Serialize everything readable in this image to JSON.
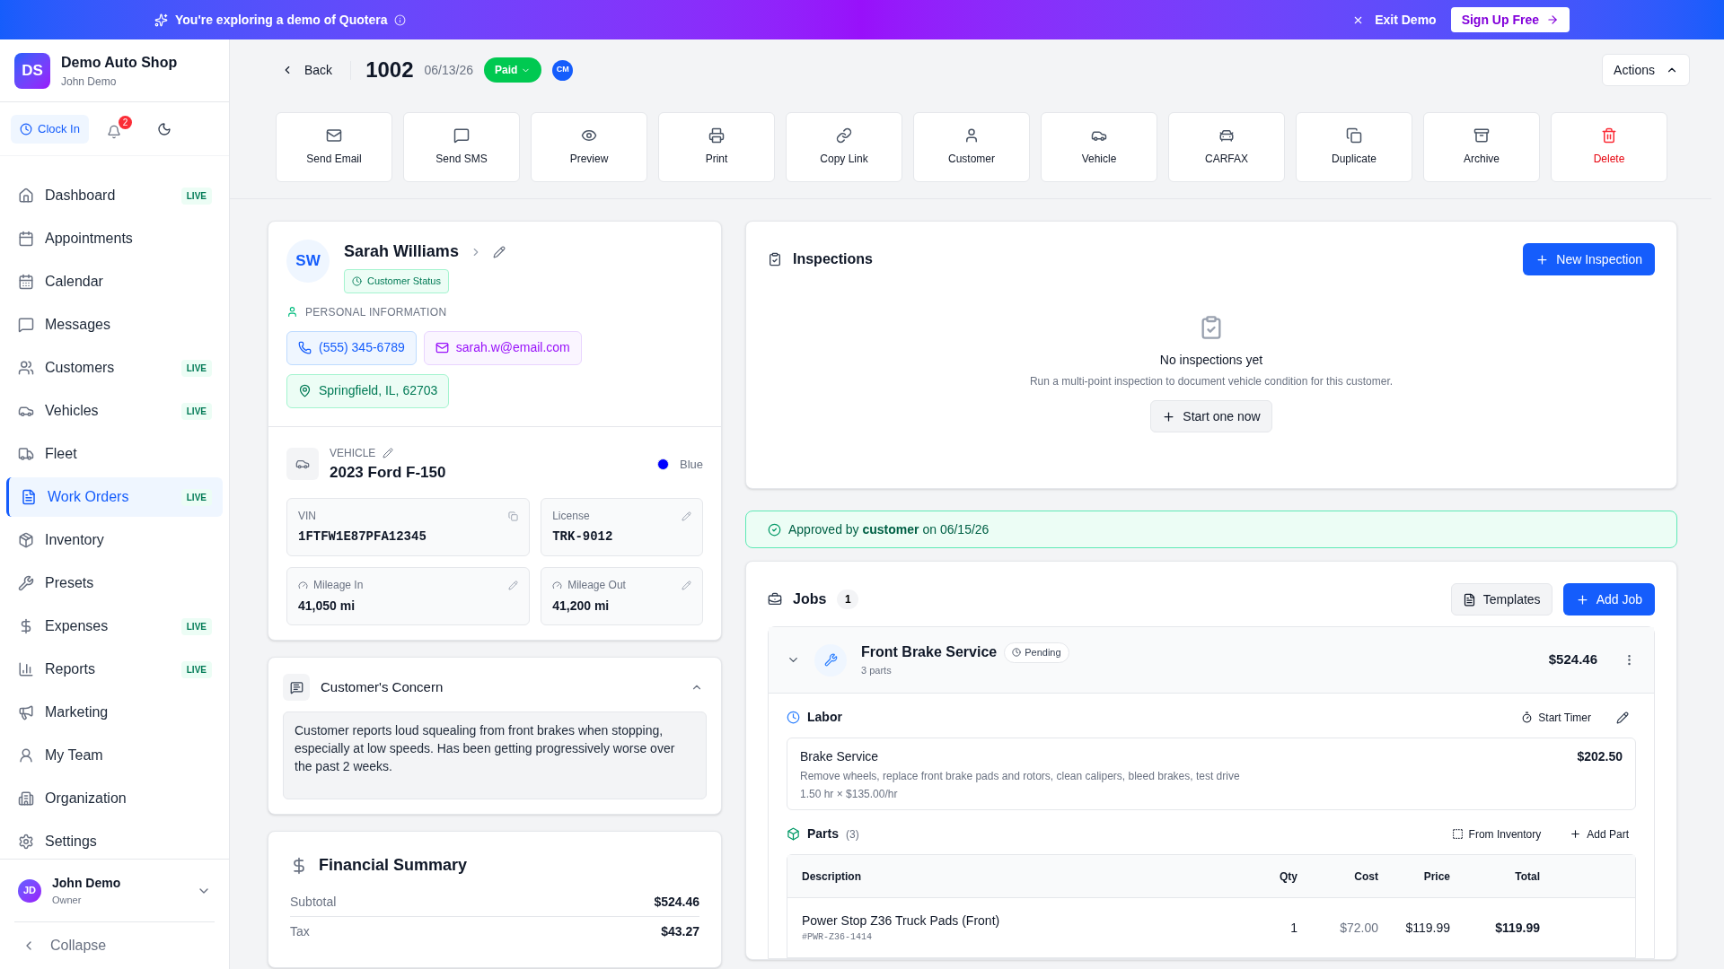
{
  "banner": {
    "message": "You're exploring a demo of Quotera",
    "exit": "Exit Demo",
    "signup": "Sign Up Free"
  },
  "sidebar": {
    "logo": "DS",
    "shop": "Demo Auto Shop",
    "user": "John Demo",
    "clock_in": "Clock In",
    "notifications": "2",
    "items": [
      {
        "label": "Dashboard",
        "badge": "LIVE",
        "selected": false
      },
      {
        "label": "Appointments",
        "selected": false
      },
      {
        "label": "Calendar",
        "selected": false
      },
      {
        "label": "Messages",
        "selected": false
      },
      {
        "label": "Customers",
        "badge": "LIVE",
        "selected": false
      },
      {
        "label": "Vehicles",
        "badge": "LIVE",
        "selected": false
      },
      {
        "label": "Fleet",
        "selected": false
      },
      {
        "label": "Work Orders",
        "badge": "LIVE",
        "selected": true
      },
      {
        "label": "Inventory",
        "selected": false
      },
      {
        "label": "Presets",
        "selected": false
      },
      {
        "label": "Expenses",
        "badge": "LIVE",
        "selected": false
      },
      {
        "label": "Reports",
        "badge": "LIVE",
        "selected": false
      },
      {
        "label": "Marketing",
        "selected": false
      },
      {
        "label": "My Team",
        "selected": false
      },
      {
        "label": "Organization",
        "selected": false
      },
      {
        "label": "Settings",
        "selected": false
      }
    ],
    "profile": {
      "initials": "JD",
      "name": "John Demo",
      "role": "Owner"
    },
    "collapse": "Collapse"
  },
  "header": {
    "back": "Back",
    "number": "1002",
    "date": "06/13/26",
    "status": "Paid",
    "assignee": "CM",
    "actions": "Actions"
  },
  "toolbar": [
    {
      "label": "Send Email",
      "kind": "default"
    },
    {
      "label": "Send SMS",
      "kind": "default"
    },
    {
      "label": "Preview",
      "kind": "default"
    },
    {
      "label": "Print",
      "kind": "default"
    },
    {
      "label": "Copy Link",
      "kind": "default"
    },
    {
      "label": "Customer",
      "kind": "default"
    },
    {
      "label": "Vehicle",
      "kind": "default"
    },
    {
      "label": "CARFAX",
      "kind": "default"
    },
    {
      "label": "Duplicate",
      "kind": "default"
    },
    {
      "label": "Archive",
      "kind": "default"
    },
    {
      "label": "Delete",
      "kind": "danger"
    }
  ],
  "customer": {
    "initials": "SW",
    "name": "Sarah Williams",
    "status": "Customer Status",
    "section": "PERSONAL INFORMATION",
    "phone": "(555) 345-6789",
    "email": "sarah.w@email.com",
    "address": "Springfield, IL, 62703"
  },
  "vehicle": {
    "label": "VEHICLE",
    "name": "2023 Ford F-150",
    "color": "#0000ff",
    "color_name": "Blue",
    "fields": [
      {
        "label": "VIN",
        "value": "1FTFW1E87PFA12345",
        "kind": "vin"
      },
      {
        "label": "License",
        "value": "TRK-9012",
        "kind": "plate"
      },
      {
        "label": "Mileage In",
        "value": "41,050 mi",
        "kind": "mileage"
      },
      {
        "label": "Mileage Out",
        "value": "41,200 mi",
        "kind": "mileage"
      }
    ]
  },
  "concern": {
    "title": "Customer's Concern",
    "expanded": true,
    "text": "Customer reports loud squealing from front brakes when stopping, especially at low speeds. Has been getting progressively worse over the past 2 weeks."
  },
  "financial": {
    "title": "Financial Summary",
    "rows": [
      {
        "label": "Subtotal",
        "value": "$524.46"
      },
      {
        "label": "Tax",
        "value": "$43.27"
      }
    ]
  },
  "inspections": {
    "title": "Inspections",
    "new": "New Inspection",
    "empty_title": "No inspections yet",
    "empty_text": "Run a multi-point inspection to document vehicle condition for this customer.",
    "start": "Start one now"
  },
  "approval": "Approved by **customer** on 06/15/26",
  "jobs": {
    "title": "Jobs",
    "count": "1",
    "templates": "Templates",
    "add": "Add Job",
    "job": {
      "name": "Front Brake Service",
      "status": "Pending",
      "parts_count": "3 parts",
      "total": "$524.46",
      "expanded": true,
      "labor": {
        "title": "Labor",
        "timer": "Start Timer",
        "name": "Brake Service",
        "description": "Remove wheels, replace front brake pads and rotors, clean calipers, bleed brakes, test drive",
        "rate": "1.50 hr × $135.00/hr",
        "amount": "$202.50"
      },
      "parts": {
        "title": "Parts",
        "count": "(3)",
        "from_inventory": "From Inventory",
        "add": "Add Part",
        "columns": [
          "Description",
          "Qty",
          "Cost",
          "Price",
          "Total"
        ],
        "rows": [
          {
            "description": "Power Stop Z36 Truck Pads (Front)",
            "sku": "#PWR-Z36-1414",
            "qty": "1",
            "cost": "$72.00",
            "price": "$119.99",
            "total": "$119.99"
          }
        ]
      }
    }
  }
}
